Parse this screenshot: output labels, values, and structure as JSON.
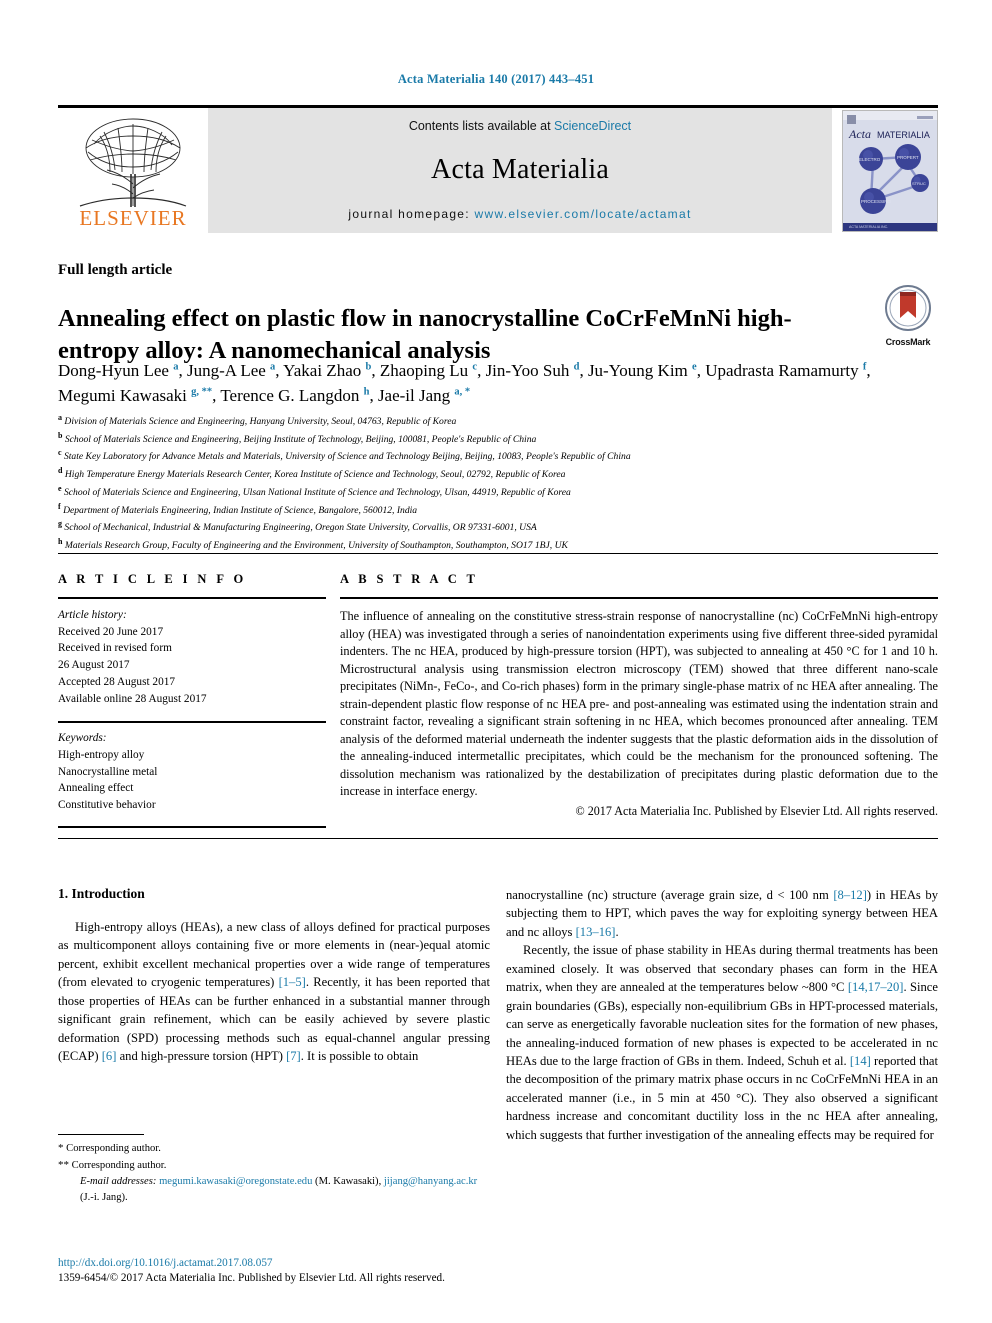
{
  "journal_ref": "Acta Materialia 140 (2017) 443–451",
  "masthead": {
    "contents_prefix": "Contents lists available at ",
    "sciencedirect": "ScienceDirect",
    "journal_title": "Acta Materialia",
    "homepage_label": "journal homepage: ",
    "homepage_url": "www.elsevier.com/locate/actamat",
    "publisher": "ELSEVIER",
    "cover_title_1": "Acta",
    "cover_title_2": "MATERIALIA"
  },
  "article": {
    "type": "Full length article",
    "title": "Annealing effect on plastic flow in nanocrystalline CoCrFeMnNi high-entropy alloy: A nanomechanical analysis",
    "crossmark": "CrossMark"
  },
  "authors": [
    {
      "name": "Dong-Hyun Lee",
      "sup": "a",
      "sep": ", "
    },
    {
      "name": "Jung-A Lee",
      "sup": "a",
      "sep": ", "
    },
    {
      "name": "Yakai Zhao",
      "sup": "b",
      "sep": ", "
    },
    {
      "name": "Zhaoping Lu",
      "sup": "c",
      "sep": ", "
    },
    {
      "name": "Jin-Yoo Suh",
      "sup": "d",
      "sep": ", "
    },
    {
      "name": "Ju-Young Kim",
      "sup": "e",
      "sep": ", "
    },
    {
      "name": "Upadrasta Ramamurty",
      "sup": "f",
      "sep": ", "
    },
    {
      "name": "Megumi Kawasaki",
      "sup": "g, **",
      "sep": ", "
    },
    {
      "name": "Terence G. Langdon",
      "sup": "h",
      "sep": ", "
    },
    {
      "name": "Jae-il Jang",
      "sup": "a, *",
      "sep": ""
    }
  ],
  "affiliations": [
    {
      "mark": "a",
      "text": "Division of Materials Science and Engineering, Hanyang University, Seoul, 04763, Republic of Korea"
    },
    {
      "mark": "b",
      "text": "School of Materials Science and Engineering, Beijing Institute of Technology, Beijing, 100081, People's Republic of China"
    },
    {
      "mark": "c",
      "text": "State Key Laboratory for Advance Metals and Materials, University of Science and Technology Beijing, Beijing, 10083, People's Republic of China"
    },
    {
      "mark": "d",
      "text": "High Temperature Energy Materials Research Center, Korea Institute of Science and Technology, Seoul, 02792, Republic of Korea"
    },
    {
      "mark": "e",
      "text": "School of Materials Science and Engineering, Ulsan National Institute of Science and Technology, Ulsan, 44919, Republic of Korea"
    },
    {
      "mark": "f",
      "text": "Department of Materials Engineering, Indian Institute of Science, Bangalore, 560012, India"
    },
    {
      "mark": "g",
      "text": "School of Mechanical, Industrial & Manufacturing Engineering, Oregon State University, Corvallis, OR 97331-6001, USA"
    },
    {
      "mark": "h",
      "text": "Materials Research Group, Faculty of Engineering and the Environment, University of Southampton, Southampton, SO17 1BJ, UK"
    }
  ],
  "info": {
    "heading": "A R T I C L E  I N F O",
    "history_label": "Article history:",
    "history": [
      "Received 20 June 2017",
      "Received in revised form",
      "26 August 2017",
      "Accepted 28 August 2017",
      "Available online 28 August 2017"
    ],
    "keywords_label": "Keywords:",
    "keywords": [
      "High-entropy alloy",
      "Nanocrystalline metal",
      "Annealing effect",
      "Constitutive behavior"
    ]
  },
  "abstract": {
    "heading": "A B S T R A C T",
    "text": "The influence of annealing on the constitutive stress-strain response of nanocrystalline (nc) CoCrFeMnNi high-entropy alloy (HEA) was investigated through a series of nanoindentation experiments using five different three-sided pyramidal indenters. The nc HEA, produced by high-pressure torsion (HPT), was subjected to annealing at 450 °C for 1 and 10 h. Microstructural analysis using transmission electron microscopy (TEM) showed that three different nano-scale precipitates (NiMn-, FeCo-, and Co-rich phases) form in the primary single-phase matrix of nc HEA after annealing. The strain-dependent plastic flow response of nc HEA pre- and post-annealing was estimated using the indentation strain and constraint factor, revealing a significant strain softening in nc HEA, which becomes pronounced after annealing. TEM analysis of the deformed material underneath the indenter suggests that the plastic deformation aids in the dissolution of the annealing-induced intermetallic precipitates, which could be the mechanism for the pronounced softening. The dissolution mechanism was rationalized by the destabilization of precipitates during plastic deformation due to the increase in interface energy.",
    "copyright": "© 2017 Acta Materialia Inc. Published by Elsevier Ltd. All rights reserved."
  },
  "body": {
    "section_heading": "1. Introduction",
    "left_paragraph_parts": [
      {
        "t": "High-entropy alloys (HEAs), a new class of alloys defined for practical purposes as multicomponent alloys containing five or more elements in (near-)equal atomic percent, exhibit excellent mechanical properties over a wide range of temperatures (from elevated to cryogenic temperatures) ",
        "cite": false
      },
      {
        "t": "[1–5]",
        "cite": true
      },
      {
        "t": ". Recently, it has been reported that those properties of HEAs can be further enhanced in a substantial manner through significant grain refinement, which can be easily achieved by severe plastic deformation (SPD) processing methods such as equal-channel angular pressing (ECAP) ",
        "cite": false
      },
      {
        "t": "[6]",
        "cite": true
      },
      {
        "t": " and high-pressure torsion (HPT) ",
        "cite": false
      },
      {
        "t": "[7]",
        "cite": true
      },
      {
        "t": ". It is possible to obtain",
        "cite": false
      }
    ],
    "right_paragraph1_parts": [
      {
        "t": "nanocrystalline (nc) structure (average grain size, d < 100 nm ",
        "cite": false
      },
      {
        "t": "[8–12]",
        "cite": true
      },
      {
        "t": ") in HEAs by subjecting them to HPT, which paves the way for exploiting synergy between HEA and nc alloys ",
        "cite": false
      },
      {
        "t": "[13–16]",
        "cite": true
      },
      {
        "t": ".",
        "cite": false
      }
    ],
    "right_paragraph2_parts": [
      {
        "t": "Recently, the issue of phase stability in HEAs during thermal treatments has been examined closely. It was observed that secondary phases can form in the HEA matrix, when they are annealed at the temperatures below ~800 °C ",
        "cite": false
      },
      {
        "t": "[14,17–20]",
        "cite": true
      },
      {
        "t": ". Since grain boundaries (GBs), especially non-equilibrium GBs in HPT-processed materials, can serve as energetically favorable nucleation sites for the formation of new phases, the annealing-induced formation of new phases is expected to be accelerated in nc HEAs due to the large fraction of GBs in them. Indeed, Schuh et al. ",
        "cite": false
      },
      {
        "t": "[14]",
        "cite": true
      },
      {
        "t": " reported that the decomposition of the primary matrix phase occurs in nc CoCrFeMnNi HEA in an accelerated manner (i.e., in 5 min at 450 °C). They also observed a significant hardness increase and concomitant ductility loss in the nc HEA after annealing, which suggests that further investigation of the annealing effects may be required for",
        "cite": false
      }
    ]
  },
  "footnotes": {
    "corr1_mark": "*",
    "corr1_text": "Corresponding author.",
    "corr2_mark": "**",
    "corr2_text": "Corresponding author.",
    "email_label": "E-mail addresses:",
    "email1": "megumi.kawasaki@oregonstate.edu",
    "email1_person": "(M. Kawasaki)",
    "email2": "jijang@hanyang.ac.kr",
    "email2_person": "(J.-i. Jang).",
    "doi": "http://dx.doi.org/10.1016/j.actamat.2017.08.057",
    "issn_line": "1359-6454/© 2017 Acta Materialia Inc. Published by Elsevier Ltd. All rights reserved."
  },
  "colors": {
    "link": "#1a7aa8",
    "elsevier_orange": "#E87722",
    "banner_bg": "#e3e3e3"
  }
}
